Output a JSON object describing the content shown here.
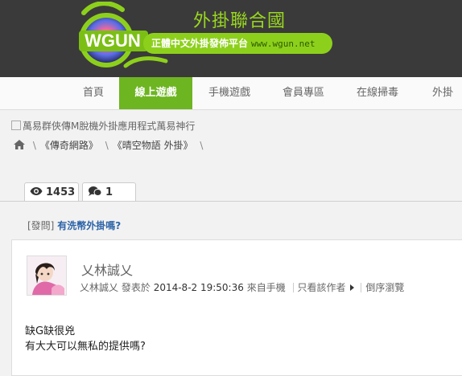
{
  "header": {
    "logo_text": "WGUN",
    "slogan": "外掛聯合國",
    "tagline": "正體中文外掛發佈平台",
    "url": "www.wgun.net"
  },
  "nav": {
    "items": [
      {
        "label": "首頁"
      },
      {
        "label": "線上遊戲"
      },
      {
        "label": "手機遊戲"
      },
      {
        "label": "會員專區"
      },
      {
        "label": "在線掃毒"
      },
      {
        "label": "外掛"
      }
    ]
  },
  "ad_alt": "萬易群俠傳M脫機外掛應用程式萬易神行",
  "breadcrumb": {
    "sep": "\\",
    "items": [
      "《傳奇網路》",
      "《晴空物語 外掛》"
    ]
  },
  "tabs": {
    "views": "1453",
    "replies": "1"
  },
  "thread": {
    "category": "[發問]",
    "title": "有洗幣外掛嗎?"
  },
  "post": {
    "author_display": "乂林誠乂",
    "author": "乂林誠乂",
    "posted_label": "發表於",
    "date": "2014-8-2 19:50:36",
    "source": "來自手機",
    "view_author_only": "只看該作者",
    "reverse_order": "倒序瀏覽",
    "content_lines": [
      "缺G缺很兇",
      "有大大可以無私的提供嗎?"
    ]
  },
  "colors": {
    "brand_green": "#6db521",
    "header_bg": "#3a3a3a",
    "link_blue": "#2e64a8"
  }
}
